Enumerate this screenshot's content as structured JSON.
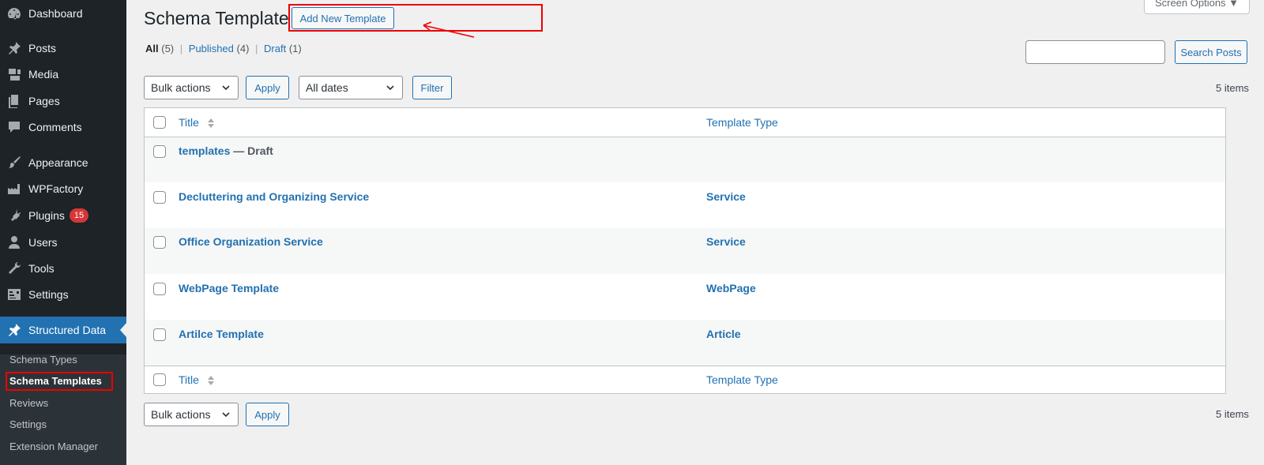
{
  "sidebar": {
    "items": [
      {
        "label": "Dashboard",
        "icon": "dashboard-icon"
      },
      {
        "label": "Posts",
        "icon": "pin-icon"
      },
      {
        "label": "Media",
        "icon": "media-icon"
      },
      {
        "label": "Pages",
        "icon": "pages-icon"
      },
      {
        "label": "Comments",
        "icon": "comments-icon"
      },
      {
        "label": "Appearance",
        "icon": "brush-icon"
      },
      {
        "label": "WPFactory",
        "icon": "factory-icon"
      },
      {
        "label": "Plugins",
        "icon": "plug-icon",
        "badge": "15"
      },
      {
        "label": "Users",
        "icon": "user-icon"
      },
      {
        "label": "Tools",
        "icon": "wrench-icon"
      },
      {
        "label": "Settings",
        "icon": "settings-icon"
      },
      {
        "label": "Structured Data",
        "icon": "pin-icon"
      }
    ],
    "submenu": [
      "Schema Types",
      "Schema Templates",
      "Reviews",
      "Settings",
      "Extension Manager"
    ]
  },
  "header": {
    "title": "Schema Template",
    "add_new_label": "Add New Template",
    "screen_options_label": "Screen Options ▼"
  },
  "filters": {
    "all_label": "All",
    "all_count": "(5)",
    "published_label": "Published",
    "published_count": "(4)",
    "draft_label": "Draft",
    "draft_count": "(1)",
    "separator": "|"
  },
  "search": {
    "button_label": "Search Posts",
    "value": ""
  },
  "toolbar": {
    "bulk_actions": "Bulk actions",
    "apply_label": "Apply",
    "dates": "All dates",
    "filter_label": "Filter",
    "items_count": "5 items"
  },
  "table": {
    "columns": {
      "title": "Title",
      "type": "Template Type"
    },
    "rows": [
      {
        "title": "templates",
        "state": "— Draft",
        "type": ""
      },
      {
        "title": "Decluttering and Organizing Service",
        "state": "",
        "type": "Service"
      },
      {
        "title": "Office Organization Service",
        "state": "",
        "type": "Service"
      },
      {
        "title": "WebPage Template",
        "state": "",
        "type": "WebPage"
      },
      {
        "title": "Artilce Template",
        "state": "",
        "type": "Article"
      }
    ]
  },
  "colors": {
    "sidebar_bg": "#1d2327",
    "accent": "#2271b1",
    "badge": "#d63638",
    "highlight": "#e00000"
  }
}
